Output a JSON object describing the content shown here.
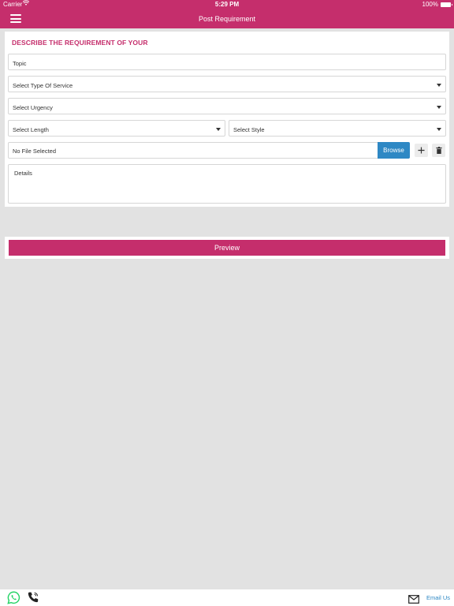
{
  "status_bar": {
    "carrier": "Carrier",
    "time": "5:29 PM",
    "battery": "100%"
  },
  "app_bar": {
    "title": "Post Requirement",
    "menu_icon": "hamburger-menu-icon"
  },
  "form": {
    "heading": "DESCRIBE THE REQUIREMENT OF YOUR",
    "topic_placeholder": "Topic",
    "service_type": "Select Type Of Service",
    "urgency": "Select Urgency",
    "length": "Select Length",
    "style": "Select Style",
    "file_status": "No File Selected",
    "browse_label": "Browse",
    "details_placeholder": "Details",
    "add_icon": "plus-icon",
    "delete_icon": "trash-icon"
  },
  "preview_label": "Preview",
  "footer": {
    "whatsapp_icon": "whatsapp-icon",
    "phone_icon": "phone-icon",
    "mail_icon": "mail-icon",
    "email_label": "Email Us"
  },
  "colors": {
    "brand": "#c52e6c",
    "browse": "#2e88c4",
    "whatsapp": "#25d366"
  }
}
